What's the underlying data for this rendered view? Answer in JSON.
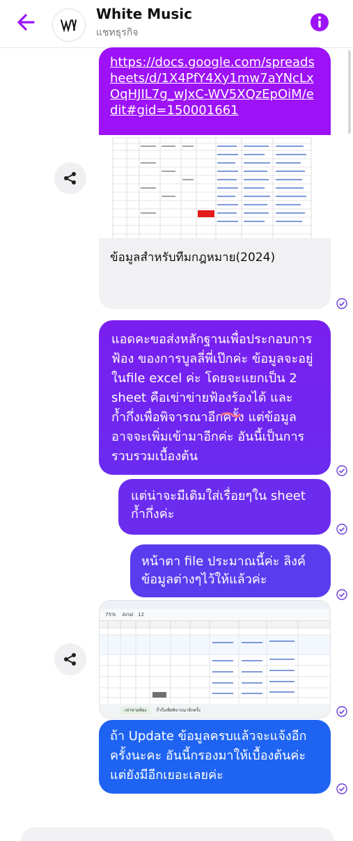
{
  "header": {
    "title": "White Music",
    "subtitle": "แชทธุรกิจ",
    "accent": "#9d12f7"
  },
  "messages": {
    "link_card": {
      "url": "https://docs.google.com/spreadsheets/d/1X4PfY4Xy1mw7aYNcLxOqHJIL7g_wJxC-WV5XQzEpOiM/edit#gid=150001661",
      "caption": "ข้อมูลสำหรับทีมกฎหมาย(2024)"
    },
    "msg1": "แอดคะขอส่งหลักฐานเพื่อประกอบการฟ้อง ของการบูลลี่พี่เป๊กค่ะ ข้อมูลจะอยู่ในfile excel ค่ะ โดยจะแยกเป็น 2 sheet คือเข่าข่ายฟ้องร้องได้ และก้ำกึ่งเพื่อพิจารณาอีกครั้ง แต่ข้อมูลอาจจะเพิ่มเข้ามาอีกค่ะ อันนี้เป็นการรวบรวมเบื้องต้น",
    "msg2": "แต่น่าจะมีเติมใส่เรื่อยๆใน sheet ก้ำกึ่งค่ะ",
    "msg3": "หน้าตา file ประมาณนี้ค่ะ ลิงค์ข้อมูลต่างๆไว้ให้แล้วค่ะ",
    "msg4": "ถ้า Update ข้อมูลครบแล้วจะแจ้งอีกครั้งนะคะ อันนี้กรองมาให้เบื้องต้นค่ะ แต่ยังมีอีกเยอะเลยค่ะ"
  },
  "screenshot": {
    "tab1": "เข่าข่ายฟ้อง",
    "tab2": "ก้ำกึ่งเพื่อพิจารณาอีกครั้ง",
    "zoom": "75%",
    "font": "Arial",
    "size": "12"
  },
  "colors": {
    "purple": "#9d12f7",
    "violet": "#6a2bf0",
    "blue": "#1e63f2",
    "check": "#6a3ed8"
  }
}
